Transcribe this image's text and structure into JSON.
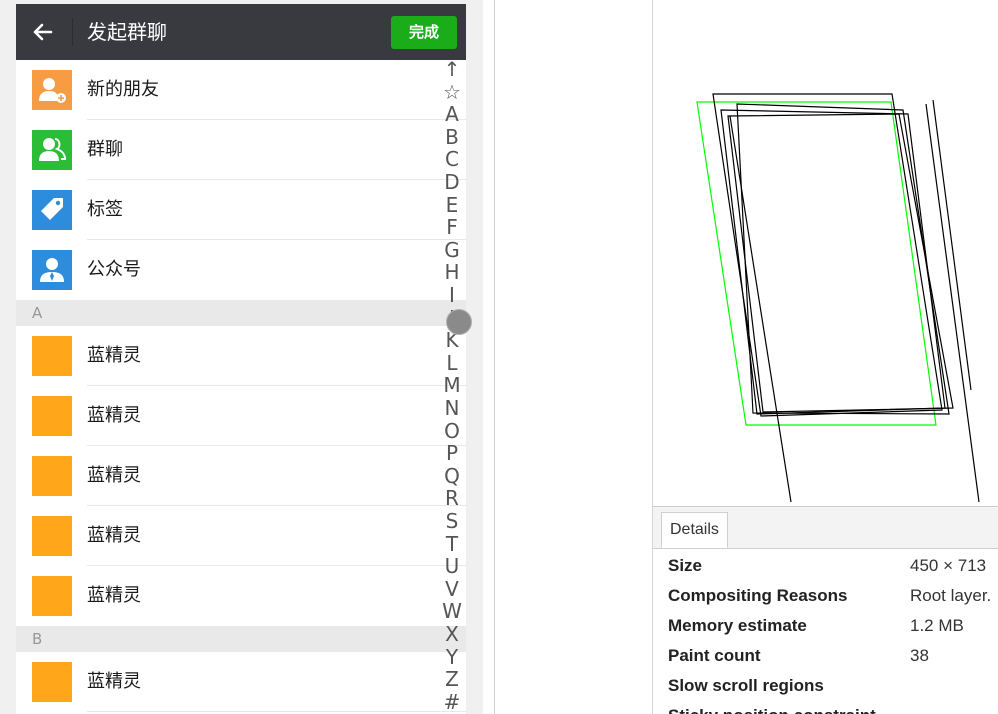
{
  "chat": {
    "title": "发起群聊",
    "done_label": "完成",
    "entries": [
      {
        "label": "新的朋友",
        "icon": "new-friends-icon",
        "color": "#f79c42"
      },
      {
        "label": "群聊",
        "icon": "group-chat-icon",
        "color": "#2bbd36"
      },
      {
        "label": "标签",
        "icon": "tag-icon",
        "color": "#2d8cdc"
      },
      {
        "label": "公众号",
        "icon": "official-account-icon",
        "color": "#2d8cdc"
      }
    ],
    "sections": [
      {
        "letter": "A",
        "contacts": [
          "蓝精灵",
          "蓝精灵",
          "蓝精灵",
          "蓝精灵",
          "蓝精灵"
        ]
      },
      {
        "letter": "B",
        "contacts": [
          "蓝精灵"
        ]
      }
    ],
    "contact_avatar_color": "#ffa61a",
    "index_letters": [
      "↑",
      "☆",
      "A",
      "B",
      "C",
      "D",
      "E",
      "F",
      "G",
      "H",
      "I",
      "J",
      "K",
      "L",
      "M",
      "N",
      "O",
      "P",
      "Q",
      "R",
      "S",
      "T",
      "U",
      "V",
      "W",
      "X",
      "Y",
      "Z",
      "#"
    ]
  },
  "devtools": {
    "tab_label": "Details",
    "properties": [
      {
        "key": "Size",
        "value": "450 × 713"
      },
      {
        "key": "Compositing Reasons",
        "value": "Root layer."
      },
      {
        "key": "Memory estimate",
        "value": "1.2 MB"
      },
      {
        "key": "Paint count",
        "value": "38"
      },
      {
        "key": "Slow scroll regions",
        "value": ""
      },
      {
        "key": "Sticky position constraint",
        "value": ""
      }
    ]
  },
  "colors": {
    "topbar": "#393a3f",
    "done_button": "#1aad19",
    "layer_highlight": "#00ff00",
    "layer_outline": "#000000"
  }
}
